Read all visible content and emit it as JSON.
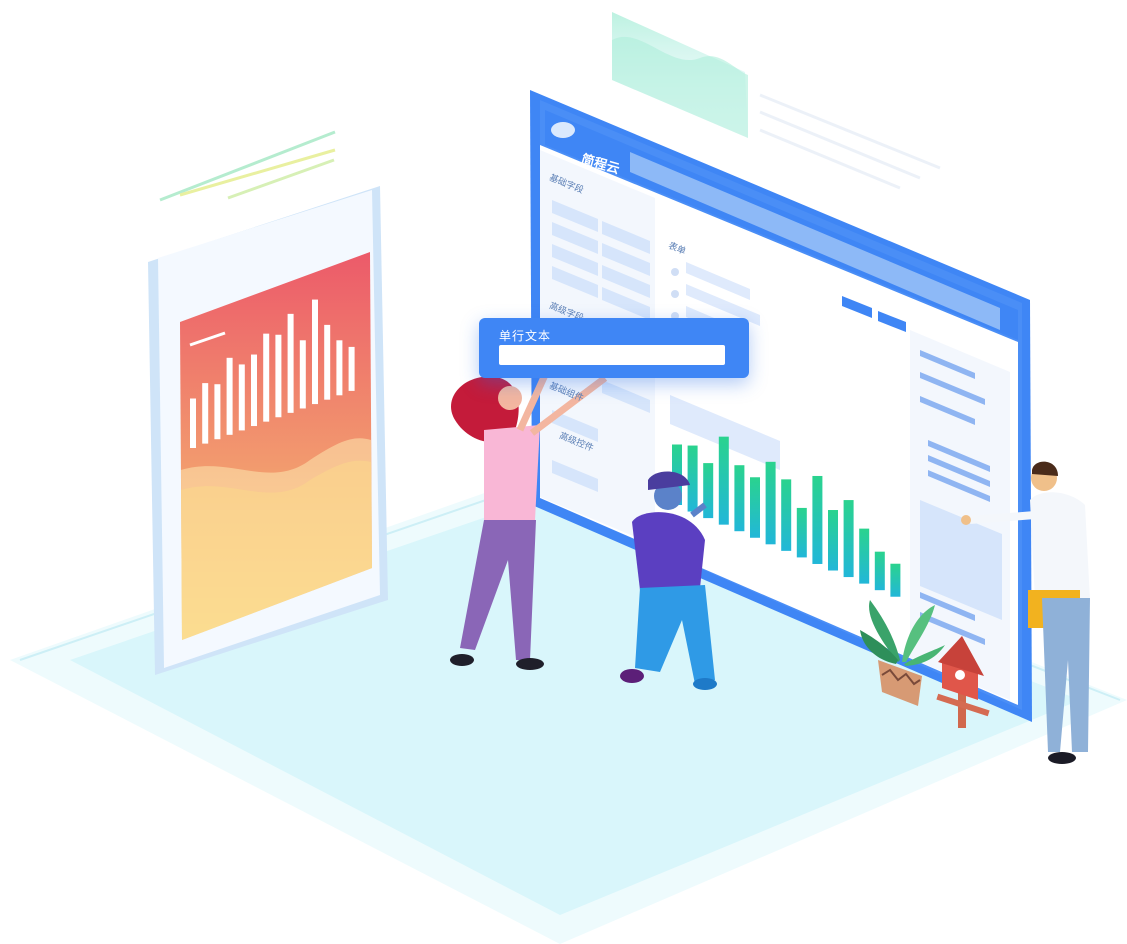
{
  "scene": {
    "floating_input": {
      "label": "单行文本",
      "value": ""
    },
    "screen": {
      "brand": "简程云",
      "labels": [
        "基础字段",
        "高级字段",
        "基础组件",
        "高级控件",
        "表单"
      ]
    },
    "phone_chart": {
      "bar_heights": [
        0.45,
        0.55,
        0.5,
        0.7,
        0.6,
        0.65,
        0.8,
        0.75,
        0.9,
        0.62,
        0.95,
        0.68,
        0.5,
        0.4
      ]
    },
    "screen_chart": {
      "bar_heights": [
        0.55,
        0.6,
        0.5,
        0.8,
        0.6,
        0.55,
        0.75,
        0.65,
        0.45,
        0.8,
        0.55,
        0.7,
        0.5,
        0.35,
        0.3
      ]
    },
    "colors": {
      "primary_blue": "#3f86f5",
      "phone_top": "#ec5a6a",
      "phone_bottom": "#f9d77a",
      "bar_green": "#2fd3a0",
      "floor": "#d8f7fb"
    }
  }
}
